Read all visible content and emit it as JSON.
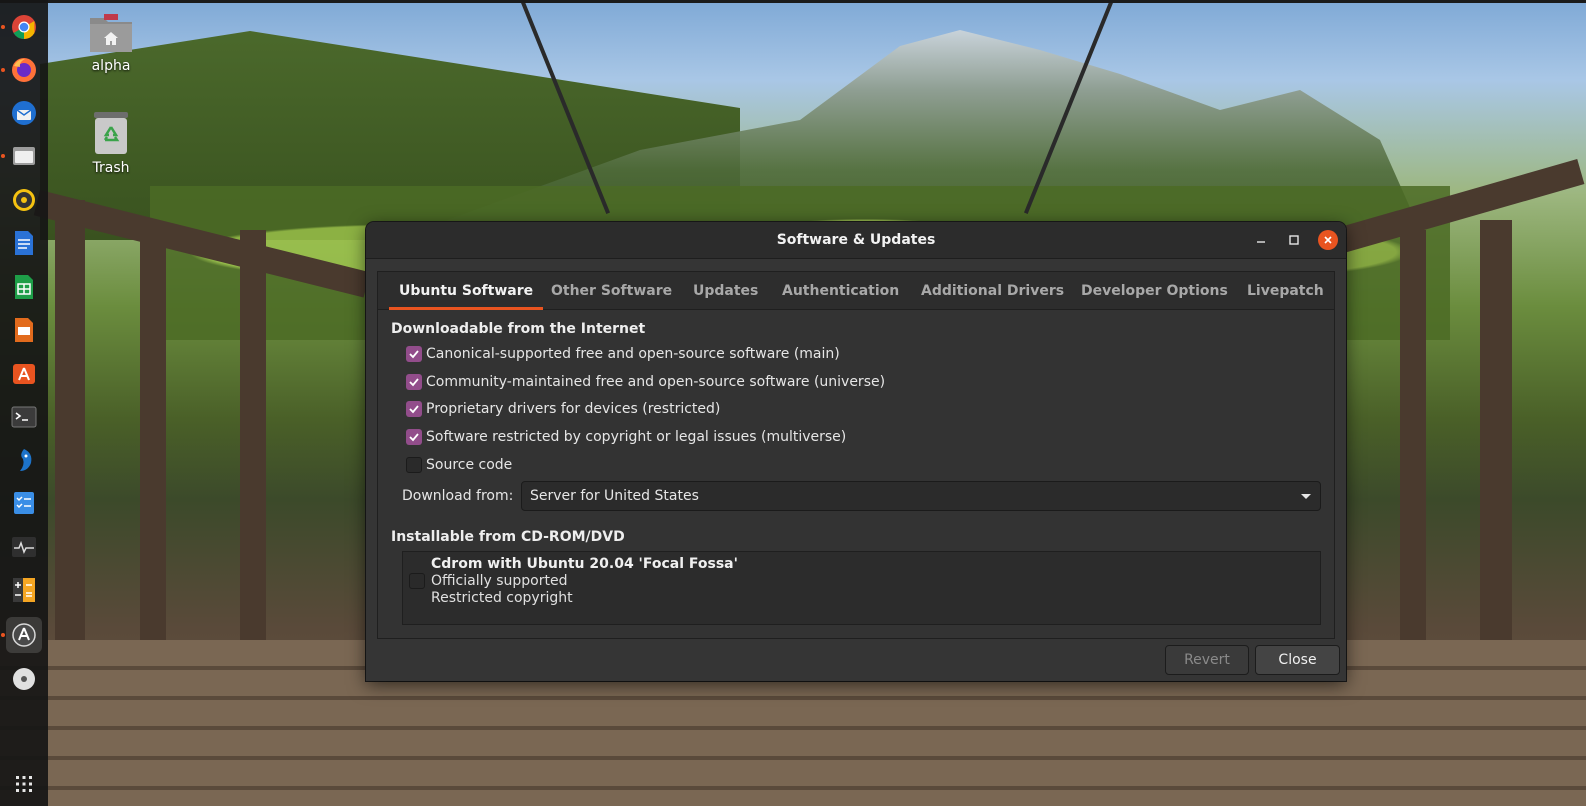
{
  "desktop": {
    "icons": [
      {
        "label": "alpha",
        "icon": "home-folder-icon"
      },
      {
        "label": "Trash",
        "icon": "trash-icon"
      }
    ]
  },
  "dock": {
    "items": [
      {
        "name": "chrome",
        "icon": "chrome-icon"
      },
      {
        "name": "firefox",
        "icon": "firefox-icon"
      },
      {
        "name": "thunderbird",
        "icon": "thunderbird-icon"
      },
      {
        "name": "files",
        "icon": "files-icon"
      },
      {
        "name": "rhythmbox",
        "icon": "rhythmbox-icon"
      },
      {
        "name": "writer",
        "icon": "libreoffice-writer-icon"
      },
      {
        "name": "calc",
        "icon": "libreoffice-calc-icon"
      },
      {
        "name": "impress",
        "icon": "libreoffice-impress-icon"
      },
      {
        "name": "software",
        "icon": "ubuntu-software-icon"
      },
      {
        "name": "terminal",
        "icon": "terminal-icon"
      },
      {
        "name": "fish",
        "icon": "app-icon"
      },
      {
        "name": "tasks",
        "icon": "tasks-icon"
      },
      {
        "name": "monitor",
        "icon": "system-monitor-icon"
      },
      {
        "name": "calculator",
        "icon": "calculator-icon"
      },
      {
        "name": "software-updates",
        "icon": "software-updates-icon"
      },
      {
        "name": "disc",
        "icon": "disc-icon"
      },
      {
        "name": "app-grid",
        "icon": "app-grid-icon"
      }
    ]
  },
  "window": {
    "title": "Software & Updates",
    "tabs": [
      {
        "label": "Ubuntu Software",
        "active": true
      },
      {
        "label": "Other Software",
        "active": false
      },
      {
        "label": "Updates",
        "active": false
      },
      {
        "label": "Authentication",
        "active": false
      },
      {
        "label": "Additional Drivers",
        "active": false
      },
      {
        "label": "Developer Options",
        "active": false
      },
      {
        "label": "Livepatch",
        "active": false
      }
    ],
    "internet_section": {
      "title": "Downloadable from the Internet",
      "options": [
        {
          "label": "Canonical-supported free and open-source software (main)",
          "checked": true
        },
        {
          "label": "Community-maintained free and open-source software (universe)",
          "checked": true
        },
        {
          "label": "Proprietary drivers for devices (restricted)",
          "checked": true
        },
        {
          "label": "Software restricted by copyright or legal issues (multiverse)",
          "checked": true
        },
        {
          "label": "Source code",
          "checked": false
        }
      ],
      "download_from_label": "Download from:",
      "download_from_value": "Server for United States"
    },
    "cdrom_section": {
      "title": "Installable from CD-ROM/DVD",
      "entry": {
        "title": "Cdrom with Ubuntu 20.04 'Focal Fossa'",
        "line1": "Officially supported",
        "line2": "Restricted copyright",
        "checked": false
      }
    },
    "buttons": {
      "revert": "Revert",
      "close": "Close"
    }
  },
  "colors": {
    "accent": "#e95420",
    "checkbox_checked": "#924d8b",
    "window_bg": "#353535",
    "titlebar_bg": "#2c2c2c"
  }
}
